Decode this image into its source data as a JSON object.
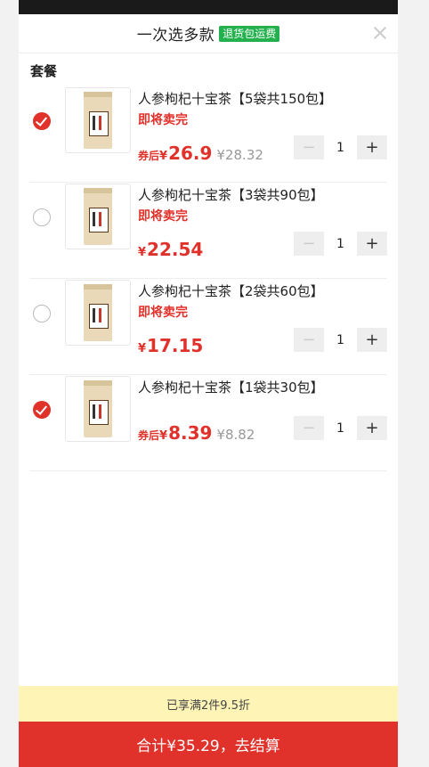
{
  "header": {
    "title": "一次选多款",
    "badge": "退货包运费"
  },
  "section": {
    "title": "套餐"
  },
  "items": [
    {
      "selected": true,
      "name": "人参枸杞十宝茶【5袋共150包】",
      "sell_tag": "即将卖完",
      "coupon_prefix": "券后",
      "currency": "¥",
      "price": "26.9",
      "original_price": "¥28.32",
      "quantity": "1"
    },
    {
      "selected": false,
      "name": "人参枸杞十宝茶【3袋共90包】",
      "sell_tag": "即将卖完",
      "coupon_prefix": "",
      "currency": "¥",
      "price": "22.54",
      "original_price": "",
      "quantity": "1"
    },
    {
      "selected": false,
      "name": "人参枸杞十宝茶【2袋共60包】",
      "sell_tag": "即将卖完",
      "coupon_prefix": "",
      "currency": "¥",
      "price": "17.15",
      "original_price": "",
      "quantity": "1"
    },
    {
      "selected": true,
      "name": "人参枸杞十宝茶【1袋共30包】",
      "sell_tag": "",
      "coupon_prefix": "券后",
      "currency": "¥",
      "price": "8.39",
      "original_price": "¥8.82",
      "quantity": "1"
    }
  ],
  "stepper": {
    "minus_symbol": "−",
    "plus_symbol": "+"
  },
  "footer": {
    "discount_text": "已享满2件9.5折",
    "checkout_label": "合计¥35.29，去结算"
  },
  "colors": {
    "accent": "#e0312a",
    "badge": "#22b14c",
    "discount_bg": "#fdf4b6"
  }
}
